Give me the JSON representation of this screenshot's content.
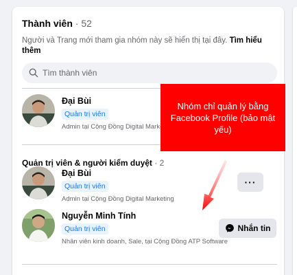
{
  "members": {
    "title": "Thành viên",
    "count_text": "· 52",
    "description": "Người và Trang mới tham gia nhóm này sẽ hiển thị tại đây.",
    "learn_more": "Tìm hiểu thêm",
    "search_placeholder": "Tìm thành viên"
  },
  "first_member": {
    "name": "Đại Bùi",
    "badge": "Quản trị viên",
    "subtitle": "Admin tại Cộng Đồng Digital Marketing"
  },
  "admins_section": {
    "title": "Quản trị viên & người kiểm duyệt",
    "count_text": "· 2",
    "members": [
      {
        "name": "Đại Bùi",
        "badge": "Quản trị viên",
        "subtitle": "Admin tại Cộng Đồng Digital Marketing",
        "action": "···"
      },
      {
        "name": "Nguyễn Minh Tính",
        "badge": "Quản trị viên",
        "subtitle": "Nhân viên kinh doanh, Sale, tại Cộng Đồng ATP Software",
        "action": "Nhắn tin"
      }
    ]
  },
  "annotation": {
    "text": "Nhóm chỉ quản lý bằng Facebook Profile (bảo mật yếu)",
    "color": "#ff0000"
  },
  "colors": {
    "accent": "#1877f2",
    "badge_bg": "#e7f3ff",
    "page_bg": "#f0f2f5"
  }
}
